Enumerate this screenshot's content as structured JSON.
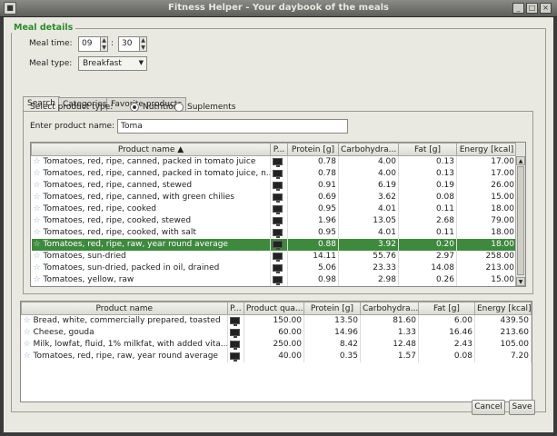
{
  "window": {
    "title": "Fitness Helper - Your daybook of the meals"
  },
  "meal": {
    "legend": "Meal details",
    "time_label": "Meal time:",
    "hour": "09",
    "minute": "30",
    "colon": ":",
    "type_label": "Meal type:",
    "type_value": "Breakfast"
  },
  "tabs": [
    "Search",
    "Categories",
    "Favorite products"
  ],
  "search": {
    "product_type_label": "Select product type:",
    "nutrition": "Nutrition",
    "suplements": "Suplements",
    "product_name_label": "Enter product name:",
    "product_name_value": "Toma"
  },
  "results": {
    "headers": [
      "Product name ▲",
      "P...",
      "Protein [g]",
      "Carbohydra...",
      "Fat [g]",
      "Energy [kcal]"
    ],
    "rows": [
      {
        "name": "Tomatoes, red, ripe, canned, packed in tomato juice",
        "protein": "0.78",
        "carb": "4.00",
        "fat": "0.13",
        "energy": "17.00"
      },
      {
        "name": "Tomatoes, red, ripe, canned, packed in tomato juice, n...",
        "protein": "0.78",
        "carb": "4.00",
        "fat": "0.13",
        "energy": "17.00"
      },
      {
        "name": "Tomatoes, red, ripe, canned, stewed",
        "protein": "0.91",
        "carb": "6.19",
        "fat": "0.19",
        "energy": "26.00"
      },
      {
        "name": "Tomatoes, red, ripe, canned, with green chilies",
        "protein": "0.69",
        "carb": "3.62",
        "fat": "0.08",
        "energy": "15.00"
      },
      {
        "name": "Tomatoes, red, ripe, cooked",
        "protein": "0.95",
        "carb": "4.01",
        "fat": "0.11",
        "energy": "18.00"
      },
      {
        "name": "Tomatoes, red, ripe, cooked, stewed",
        "protein": "1.96",
        "carb": "13.05",
        "fat": "2.68",
        "energy": "79.00"
      },
      {
        "name": "Tomatoes, red, ripe, cooked, with salt",
        "protein": "0.95",
        "carb": "4.01",
        "fat": "0.11",
        "energy": "18.00"
      },
      {
        "name": "Tomatoes, red, ripe, raw, year round average",
        "protein": "0.88",
        "carb": "3.92",
        "fat": "0.20",
        "energy": "18.00"
      },
      {
        "name": "Tomatoes, sun-dried",
        "protein": "14.11",
        "carb": "55.76",
        "fat": "2.97",
        "energy": "258.00"
      },
      {
        "name": "Tomatoes, sun-dried, packed in oil, drained",
        "protein": "5.06",
        "carb": "23.33",
        "fat": "14.08",
        "energy": "213.00"
      },
      {
        "name": "Tomatoes, yellow, raw",
        "protein": "0.98",
        "carb": "2.98",
        "fat": "0.26",
        "energy": "15.00"
      }
    ]
  },
  "meal_items": {
    "headers": [
      "Product name",
      "P...",
      "Product qua...",
      "Protein [g]",
      "Carbohydra...",
      "Fat [g]",
      "Energy [kcal]"
    ],
    "rows": [
      {
        "name": "Bread, white, commercially prepared, toasted",
        "qty": "150.00",
        "protein": "13.50",
        "carb": "81.60",
        "fat": "6.00",
        "energy": "439.50"
      },
      {
        "name": "Cheese, gouda",
        "qty": "60.00",
        "protein": "14.96",
        "carb": "1.33",
        "fat": "16.46",
        "energy": "213.60"
      },
      {
        "name": "Milk, lowfat, fluid, 1% milkfat, with added vita...",
        "qty": "250.00",
        "protein": "8.42",
        "carb": "12.48",
        "fat": "2.43",
        "energy": "105.00"
      },
      {
        "name": "Tomatoes, red, ripe, raw, year round average",
        "qty": "40.00",
        "protein": "0.35",
        "carb": "1.57",
        "fat": "0.08",
        "energy": "7.20"
      }
    ]
  },
  "buttons": {
    "cancel": "Cancel",
    "save": "Save"
  },
  "colors": {
    "legend_green": "#2c8a2c",
    "selection_green": "#3d8a3d"
  }
}
